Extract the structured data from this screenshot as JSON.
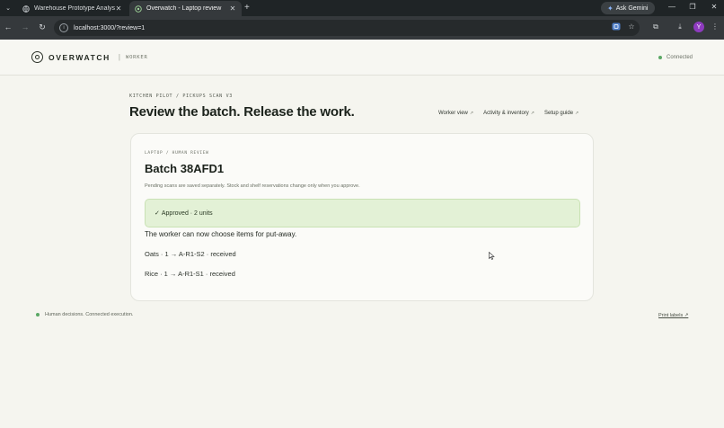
{
  "browser": {
    "tabs": [
      {
        "title": "Warehouse Prototype Analysis",
        "active": false
      },
      {
        "title": "Overwatch - Laptop review",
        "active": true
      }
    ],
    "new_tab_icon": "plus-icon",
    "ask_gemini_label": "Ask Gemini",
    "url": "localhost:3000/?review=1",
    "profile_initial": "Y"
  },
  "header": {
    "brand_name": "OVERWATCH",
    "separator": "|",
    "role_label": "WORKER",
    "connection_status": "Connected"
  },
  "main": {
    "eyebrow": "KITCHEN PILOT / PICKUPS SCAN V3",
    "title": "Review the batch. Release the work.",
    "links": [
      {
        "label": "Worker view",
        "arrow": "↗"
      },
      {
        "label": "Activity & inventory",
        "arrow": "↗"
      },
      {
        "label": "Setup guide",
        "arrow": "↗"
      }
    ]
  },
  "card": {
    "eyebrow": "LAPTOP / HUMAN REVIEW",
    "batch_title": "Batch 38AFD1",
    "note": "Pending scans are saved separately. Stock and shelf reservations change only when you approve.",
    "approved_check": "✓",
    "approved_text": "Approved · 2 units",
    "worker_message": "The worker can now choose items for put-away.",
    "items": [
      "Oats · 1 → A-R1-S2 · received",
      "Rice · 1 → A-R1-S1 · received"
    ]
  },
  "footer": {
    "status_text": "Human decisions. Connected execution.",
    "print_labels": "Print labels ↗"
  },
  "colors": {
    "page_bg": "#f5f5ef",
    "approved_bg": "#e3f1d6",
    "status_green": "#5aa865",
    "browser_dark": "#1f2426"
  }
}
